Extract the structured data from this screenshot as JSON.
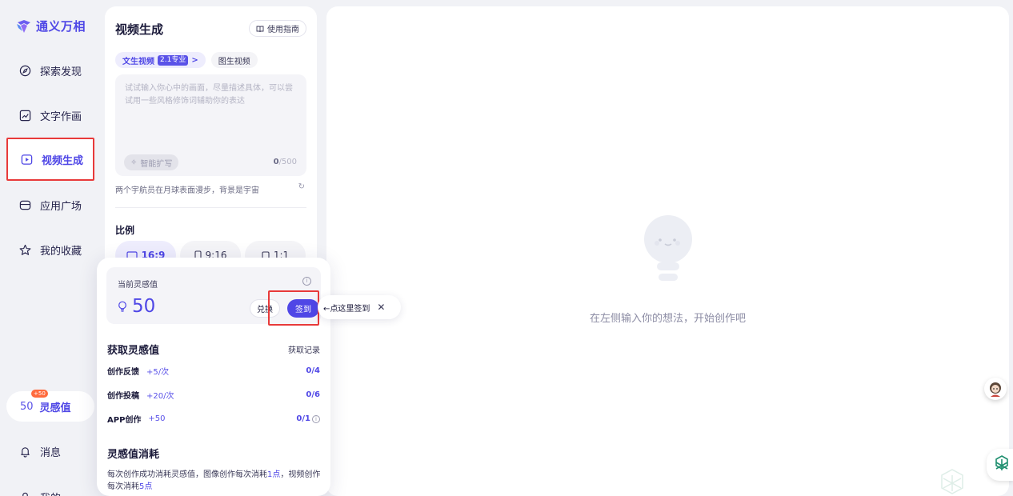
{
  "brand": {
    "name": "通义万相"
  },
  "nav": {
    "items": [
      {
        "label": "探索发现",
        "icon": "compass-icon"
      },
      {
        "label": "文字作画",
        "icon": "image-edit-icon"
      },
      {
        "label": "视频生成",
        "icon": "video-icon"
      },
      {
        "label": "应用广场",
        "icon": "store-icon"
      },
      {
        "label": "我的收藏",
        "icon": "star-icon"
      }
    ],
    "active": "视频生成",
    "inspire": {
      "value": "50",
      "label": "灵感值",
      "badge": "+50"
    },
    "messages": "消息",
    "mine": "我的"
  },
  "panel": {
    "title": "视频生成",
    "guide": "使用指南",
    "tabs": [
      {
        "label": "文生视频",
        "version": "2.1专业"
      },
      {
        "label": "图生视频"
      }
    ],
    "prompt": {
      "placeholder": "试试输入你心中的画面，尽量描述具体，可以尝试用一些风格修饰词辅助你的表达",
      "smart_label": "智能扩写",
      "count": "0",
      "max": "/500"
    },
    "suggestion": "两个宇航员在月球表面漫步，背景是宇宙",
    "ratio": {
      "title": "比例",
      "options": [
        "16:9",
        "9:16",
        "1:1"
      ],
      "selected": "16:9"
    }
  },
  "popover": {
    "current_label": "当前灵感值",
    "value": "50",
    "redeem": "兑换",
    "checkin": "签到",
    "earn_title": "获取灵感值",
    "history": "获取记录",
    "tasks": [
      {
        "name": "创作反馈",
        "reward": "+5/次",
        "progress": "0/4"
      },
      {
        "name": "创作投稿",
        "reward": "+20/次",
        "progress": "0/6"
      },
      {
        "name": "APP创作",
        "reward": "+50",
        "progress": "0/1"
      }
    ],
    "cost_title": "灵感值消耗",
    "cost_desc": {
      "part1": "每次创作成功消耗灵感值，图像创作每次消耗",
      "img_cost": "1点",
      "part2": "，视频创作每次消耗",
      "video_cost": "5点"
    }
  },
  "tooltip": {
    "text": "←点这里签到",
    "close": "✕"
  },
  "main": {
    "empty_text": "在左侧输入你的想法，开始创作吧"
  },
  "colors": {
    "accent": "#4f47e6",
    "highlight_box": "#e83a3a",
    "background": "#f1f2f6"
  }
}
